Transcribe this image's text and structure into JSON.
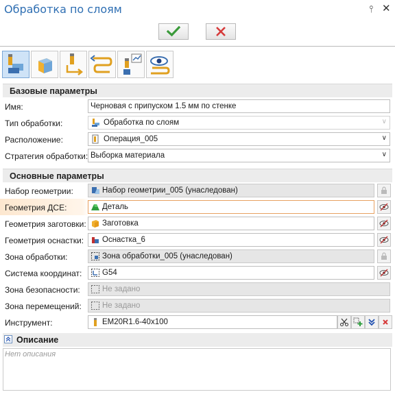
{
  "window": {
    "title": "Обработка по слоям"
  },
  "sections": {
    "basic": "Базовые параметры",
    "main": "Основные параметры",
    "description": "Описание"
  },
  "basic": {
    "name_label": "Имя:",
    "name_value": "Черновая с припуском 1.5 мм по стенке",
    "type_label": "Тип обработки:",
    "type_value": "Обработка по слоям",
    "location_label": "Расположение:",
    "location_value": "Операция_005",
    "strategy_label": "Стратегия обработки:",
    "strategy_value": "Выборка материала"
  },
  "main": {
    "geomset_label": "Набор геометрии:",
    "geomset_value": "Набор геометрии_005 (унаследован)",
    "part_label": "Геометрия ДСЕ:",
    "part_value": "Деталь",
    "stock_label": "Геометрия заготовки:",
    "stock_value": "Заготовка",
    "fixture_label": "Геометрия оснастки:",
    "fixture_value": "Оснастка_6",
    "zone_label": "Зона обработки:",
    "zone_value": "Зона обработки_005 (унаследован)",
    "cs_label": "Система координат:",
    "cs_value": "G54",
    "safety_label": "Зона безопасности:",
    "safety_value": "Не задано",
    "moves_label": "Зона перемещений:",
    "moves_value": "Не задано",
    "tool_label": "Инструмент:",
    "tool_value": "EM20R1.6-40x100"
  },
  "description": {
    "placeholder": "Нет описания"
  },
  "colors": {
    "title": "#2f6fb3",
    "ok": "#3a9a3a",
    "cancel": "#d63a3a",
    "highlight": "#fde7cf"
  }
}
